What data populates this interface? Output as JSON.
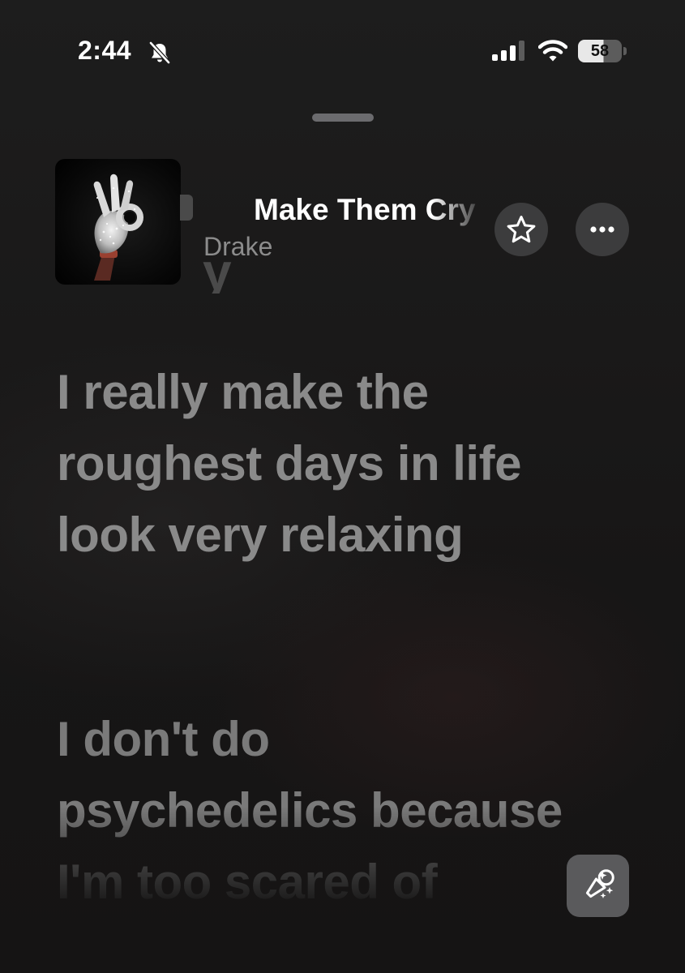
{
  "status_bar": {
    "time": "2:44",
    "battery_level": "58",
    "icons": [
      "bell-slash-icon",
      "cellular-signal-icon",
      "wifi-icon",
      "battery-icon"
    ]
  },
  "now_playing": {
    "artwork_icon": "ok-hand-glove-artwork",
    "title": "Make Them Cry",
    "artist": "Drake",
    "actions": [
      "star-icon",
      "ellipsis-icon"
    ]
  },
  "lyrics": {
    "partial_line": "y",
    "current_line": "I really make the roughest days in life look very relaxing",
    "next_line": "I don't do psychedelics because I'm too scared of"
  },
  "controls": {
    "sing_icon": "microphone-sparkles-icon"
  },
  "colors": {
    "background": "#1a1919",
    "lyric_text": "#8a8a8a",
    "button_bg": "#3c3c3d",
    "sing_button_bg": "#5a5a5c"
  }
}
